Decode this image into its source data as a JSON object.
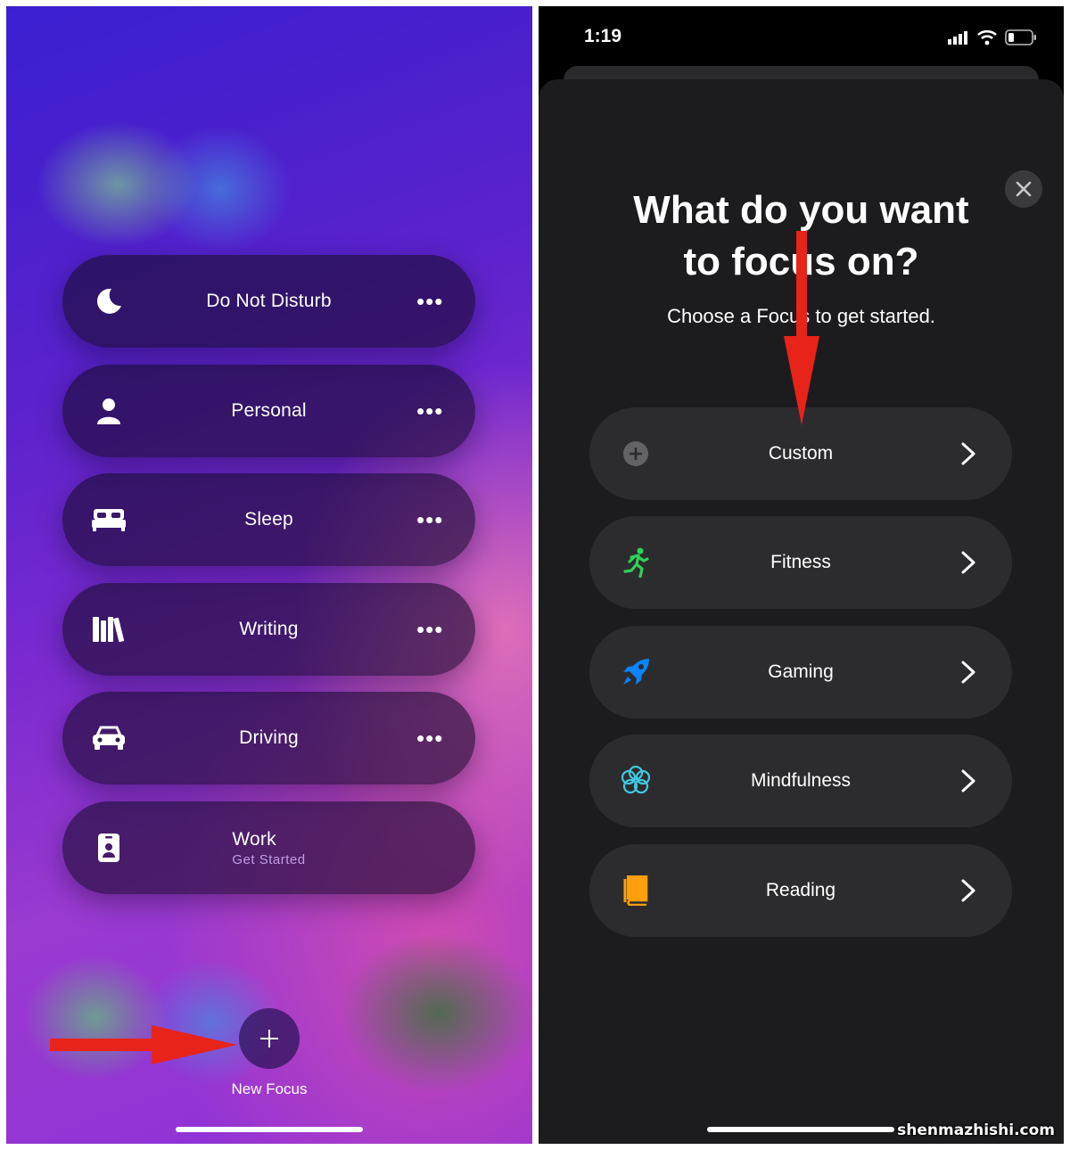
{
  "left": {
    "focus_items": [
      {
        "label": "Do Not Disturb",
        "icon": "moon-icon",
        "more": "•••"
      },
      {
        "label": "Personal",
        "icon": "person-icon",
        "more": "•••"
      },
      {
        "label": "Sleep",
        "icon": "bed-icon",
        "more": "•••"
      },
      {
        "label": "Writing",
        "icon": "books-icon",
        "more": "•••"
      },
      {
        "label": "Driving",
        "icon": "car-icon",
        "more": "•••"
      },
      {
        "label": "Work",
        "sublabel": "Get Started",
        "icon": "badge-icon"
      }
    ],
    "new_focus_label": "New Focus",
    "new_focus_icon": "plus-icon"
  },
  "right": {
    "status_time": "1:19",
    "title_line1": "What do you want",
    "title_line2": "to focus on?",
    "subtitle": "Choose a Focus to get started.",
    "options": [
      {
        "label": "Custom",
        "icon": "plus-circle-icon",
        "color": "#8e8e93"
      },
      {
        "label": "Fitness",
        "icon": "running-icon",
        "color": "#30d158"
      },
      {
        "label": "Gaming",
        "icon": "rocket-icon",
        "color": "#0a84ff"
      },
      {
        "label": "Mindfulness",
        "icon": "flower-icon",
        "color": "#40c8e0"
      },
      {
        "label": "Reading",
        "icon": "book-icon",
        "color": "#ff9f0a"
      }
    ]
  },
  "annotation_color": "#e8231a",
  "watermark": "shenmazhishi.com"
}
